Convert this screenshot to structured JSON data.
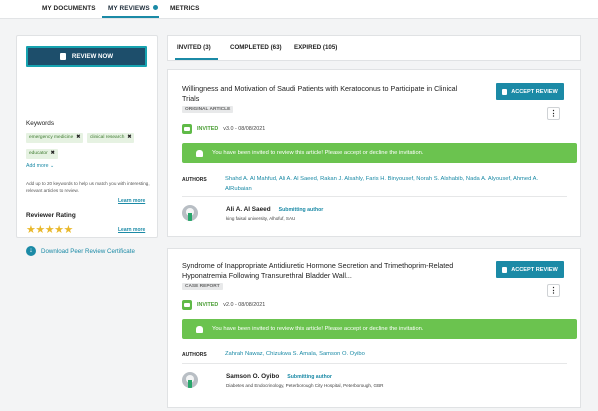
{
  "topnav": {
    "tabs": [
      {
        "label": "MY DOCUMENTS"
      },
      {
        "label": "MY REVIEWS"
      },
      {
        "label": "METRICS"
      }
    ],
    "active_tab": "MY REVIEWS",
    "accent": "#1b8aa6"
  },
  "sidebar": {
    "review_now": "REVIEW NOW",
    "keywords_title": "Keywords",
    "keywords": [
      "emergency medicine",
      "clinical research",
      "educator"
    ],
    "add_more": "Add more",
    "help_text": "Add up to 20 keywords to help us match you with interesting, relevant articles to review.",
    "learn_more": "Learn more",
    "rating_title": "Reviewer Rating",
    "rating": 4.5,
    "rating_stars": "★★★★★",
    "download_label": "Download Peer Review Certificate"
  },
  "subtabs": [
    {
      "label": "INVITED (3)"
    },
    {
      "label": "COMPLETED (63)"
    },
    {
      "label": "EXPIRED (105)"
    }
  ],
  "cards": [
    {
      "title": "Willingness and Motivation of Saudi Patients with Keratoconus to Participate in Clinical Trials",
      "type": "ORIGINAL ARTICLE",
      "accept": "ACCEPT REVIEW",
      "status": "INVITED",
      "version": "v3.0 - 08/08/2021",
      "banner": "You have been invited to review this article! Please accept or decline the invitation.",
      "authors_label": "AUTHORS",
      "authors": "Shahd A. Al Mahfud, Ali A. Al Saeed, Rakan J. Alsahly, Faris H. Binyousef, Norah S. Alshabib, Nada A. Alyousef, Ahmed A. AlRubaian",
      "submitter": "Ali A. Al Saeed",
      "submitter_role": "Submitting author",
      "affiliation": "king faisal university, Alhofuf, SAU"
    },
    {
      "title": "Syndrome of Inappropriate Antidiuretic Hormone Secretion and Trimethoprim-Related Hyponatremia Following Transurethral Bladder Wall...",
      "type": "CASE REPORT",
      "accept": "ACCEPT REVIEW",
      "status": "INVITED",
      "version": "v2.0 - 08/08/2021",
      "banner": "You have been invited to review this article! Please accept or decline the invitation.",
      "authors_label": "AUTHORS",
      "authors": "Zahrah Nawaz, Chizukwa S. Amala, Samson O. Oyibo",
      "submitter": "Samson O. Oyibo",
      "submitter_role": "Submitting author",
      "affiliation": "Diabetes and Endocrinology, Peterborough City Hospital, Peterborough, GBR"
    }
  ]
}
